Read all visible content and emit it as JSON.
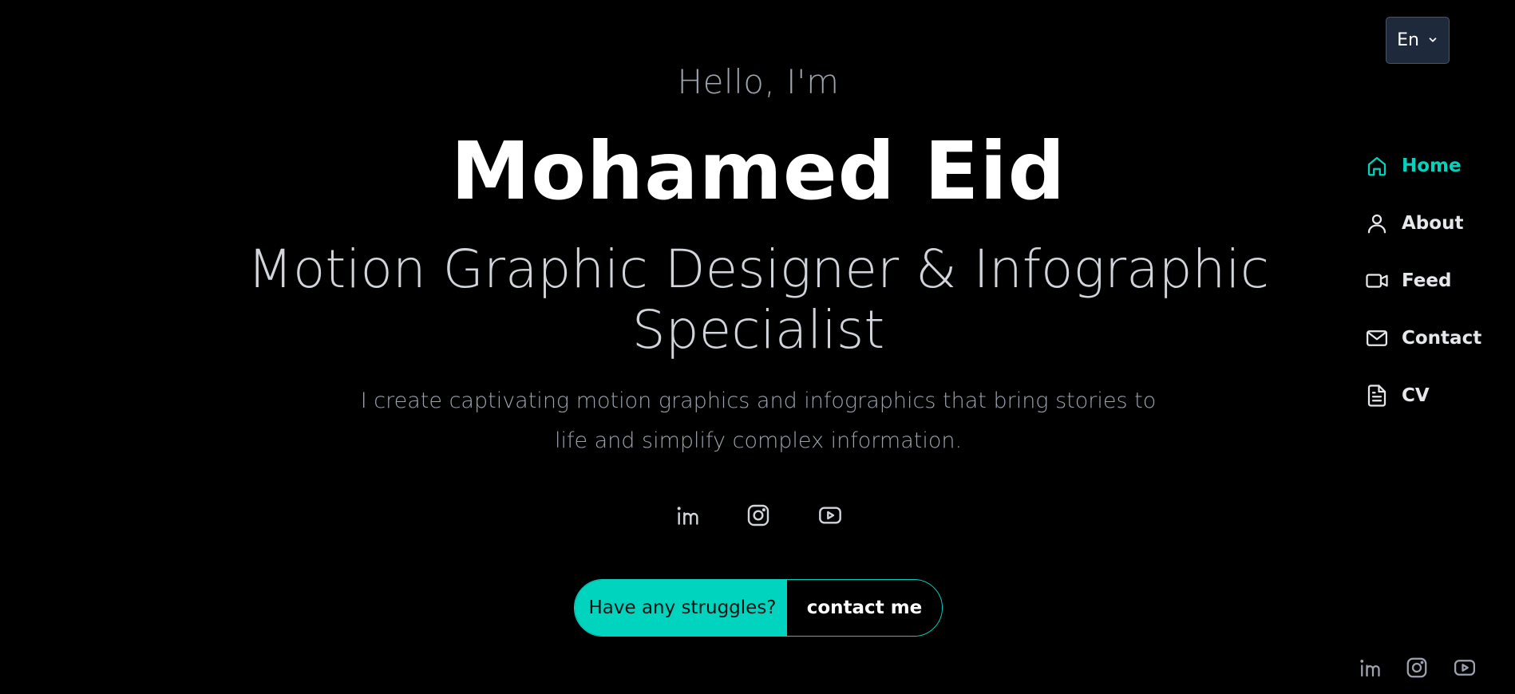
{
  "language_select": {
    "value": "En"
  },
  "hero": {
    "greeting": "Hello, I'm",
    "name": "Mohamed Eid",
    "role": "Motion Graphic Designer & Infographic Specialist",
    "intro": "I create captivating motion graphics and infographics that bring stories to life and simplify complex information.",
    "social": [
      {
        "icon": "linkedin-icon"
      },
      {
        "icon": "instagram-icon"
      },
      {
        "icon": "youtube-icon"
      }
    ],
    "cta": {
      "prompt": "Have any struggles?",
      "action": "contact me"
    }
  },
  "nav": {
    "items": [
      {
        "label": "Home",
        "icon": "home-icon",
        "active": true
      },
      {
        "label": "About",
        "icon": "user-icon",
        "active": false
      },
      {
        "label": "Feed",
        "icon": "video-icon",
        "active": false
      },
      {
        "label": "Contact",
        "icon": "mail-icon",
        "active": false
      },
      {
        "label": "CV",
        "icon": "document-icon",
        "active": false
      }
    ]
  },
  "corner_social": [
    {
      "icon": "linkedin-icon"
    },
    {
      "icon": "instagram-icon"
    },
    {
      "icon": "youtube-icon"
    }
  ],
  "colors": {
    "accent": "#00d4bf",
    "background": "#000000",
    "select_bg": "#1e293b"
  }
}
